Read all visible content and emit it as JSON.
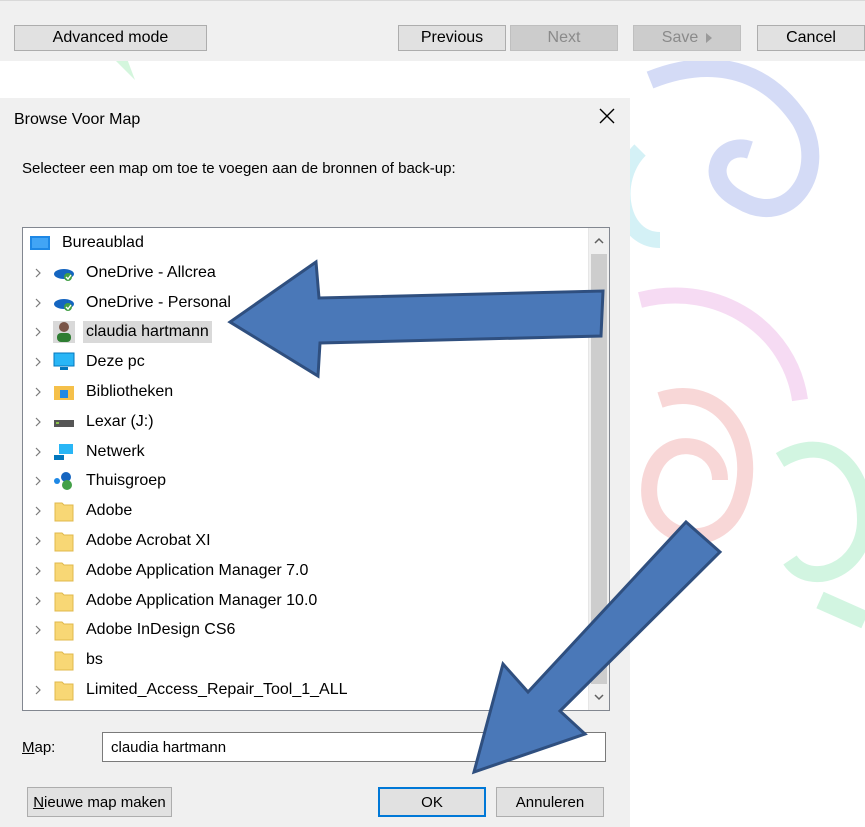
{
  "toolbar": {
    "advanced_label": "Advanced mode",
    "previous_label": "Previous",
    "next_label": "Next",
    "save_label": "Save",
    "cancel_label": "Cancel"
  },
  "dialog": {
    "title": "Browse Voor Map",
    "message": "Selecteer een map om toe te voegen aan de bronnen of back-up:",
    "map_label_first": "M",
    "map_label_rest": "ap:",
    "map_value": "claudia hartmann",
    "new_folder_first": "N",
    "new_folder_rest": "ieuwe map maken",
    "ok_label": "OK",
    "cancel_label": "Annuleren"
  },
  "tree": {
    "items": [
      {
        "label": "Bureaublad",
        "icon": "desktop-icon"
      },
      {
        "label": "OneDrive - Allcrea",
        "icon": "onedrive-icon"
      },
      {
        "label": "OneDrive - Personal",
        "icon": "onedrive-icon"
      },
      {
        "label": "claudia hartmann",
        "icon": "user-icon",
        "selected": true
      },
      {
        "label": "Deze pc",
        "icon": "computer-icon"
      },
      {
        "label": "Bibliotheken",
        "icon": "library-icon"
      },
      {
        "label": "Lexar (J:)",
        "icon": "drive-icon"
      },
      {
        "label": "Netwerk",
        "icon": "network-icon"
      },
      {
        "label": "Thuisgroep",
        "icon": "homegroup-icon"
      },
      {
        "label": "Adobe",
        "icon": "folder-icon"
      },
      {
        "label": "Adobe Acrobat XI",
        "icon": "folder-icon"
      },
      {
        "label": "Adobe Application Manager 7.0",
        "icon": "folder-icon"
      },
      {
        "label": "Adobe Application Manager 10.0",
        "icon": "folder-icon"
      },
      {
        "label": "Adobe InDesign CS6",
        "icon": "folder-icon"
      },
      {
        "label": "bs",
        "icon": "folder-icon"
      },
      {
        "label": "Limited_Access_Repair_Tool_1_ALL",
        "icon": "folder-icon"
      }
    ]
  },
  "colors": {
    "arrow_fill": "#4a78b8",
    "arrow_stroke": "#2f4f7f",
    "selection": "#d9d9d9",
    "default_button_border": "#0078d7"
  }
}
